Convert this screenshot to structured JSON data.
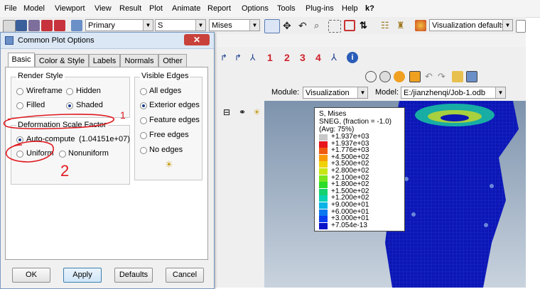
{
  "menu": [
    "File",
    "Model",
    "Viewport",
    "View",
    "Result",
    "Plot",
    "Animate",
    "Report",
    "Options",
    "Tools",
    "Plug-ins",
    "Help",
    "k?"
  ],
  "toolbar": {
    "primary_combo": "Primary",
    "s_combo": "S",
    "mises_combo": "Mises",
    "viz_defaults_combo": "Visualization defaults"
  },
  "number_buttons": [
    "1",
    "2",
    "3",
    "4"
  ],
  "module_bar": {
    "module_label": "Module:",
    "module_value": "Visualization",
    "model_label": "Model:",
    "model_value": "E:/jianzhenqi/Job-1.odb"
  },
  "dialog": {
    "title": "Common Plot Options",
    "tabs": [
      "Basic",
      "Color & Style",
      "Labels",
      "Normals",
      "Other"
    ],
    "render_style": {
      "title": "Render Style",
      "options": [
        "Wireframe",
        "Hidden",
        "Filled",
        "Shaded"
      ],
      "selected": "Shaded"
    },
    "visible_edges": {
      "title": "Visible Edges",
      "options": [
        "All edges",
        "Exterior edges",
        "Feature edges",
        "Free edges",
        "No edges"
      ],
      "selected": "Exterior edges"
    },
    "deformation": {
      "title": "Deformation Scale Factor",
      "auto_label": "Auto-compute",
      "auto_value": "(1.04151e+07)",
      "uniform_label": "Uniform",
      "nonuniform_label": "Nonuniform",
      "selected": "Auto-compute"
    },
    "buttons": [
      "OK",
      "Apply",
      "Defaults",
      "Cancel"
    ]
  },
  "legend": {
    "line1": "S, Mises",
    "line2": "SNEG, (fraction = -1.0)",
    "line3": "(Avg: 75%)",
    "values": [
      "+1.937e+03",
      "+1.937e+03",
      "+1.776e+03",
      "+4.500e+02",
      "+3.500e+02",
      "+2.800e+02",
      "+2.100e+02",
      "+1.800e+02",
      "+1.500e+02",
      "+1.200e+02",
      "+9.000e+01",
      "+6.000e+01",
      "+3.000e+01",
      "+7.054e-13"
    ],
    "colors": [
      "#c8c8c8",
      "#e8141c",
      "#f05a10",
      "#f89a0a",
      "#f0d20a",
      "#c8e614",
      "#78e61e",
      "#28dc28",
      "#14d26e",
      "#0ad2b4",
      "#0ab4e6",
      "#0a78f0",
      "#0a3cf0",
      "#0a14c8"
    ]
  },
  "annotations": {
    "one": "1",
    "two": "2"
  },
  "colors": {
    "accent": "#1a3c8c",
    "annotation": "#e0191f",
    "viewport_top": "#7d93ad"
  }
}
